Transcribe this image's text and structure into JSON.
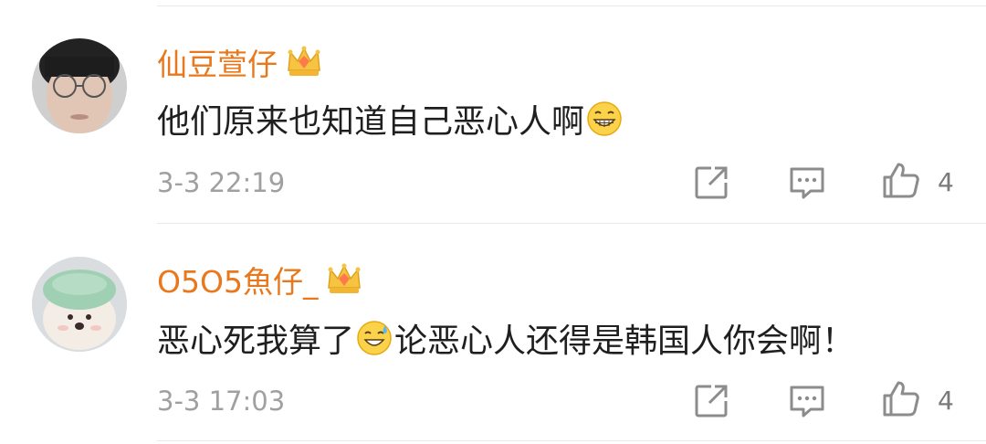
{
  "comments": [
    {
      "username": "仙豆萱仔",
      "badge_icon": "vip-crown-icon",
      "text_before": "他们原来也知道自己恶心人啊",
      "text_after": "",
      "emoji": "grinning-face-emoji",
      "time": "3-3 22:19",
      "like_count": "4"
    },
    {
      "username": "O5O5魚仔_",
      "badge_icon": "vip-crown-icon",
      "text_before": "恶心死我算了",
      "text_after": "论恶心人还得是韩国人你会啊！",
      "emoji": "sweat-smile-emoji",
      "time": "3-3 17:03",
      "like_count": "4"
    }
  ],
  "colors": {
    "username": "#e8781b",
    "text": "#1f1f1f",
    "meta": "#a0a0a0",
    "icon": "#8c8c8c",
    "divider": "#e9e9e9"
  }
}
